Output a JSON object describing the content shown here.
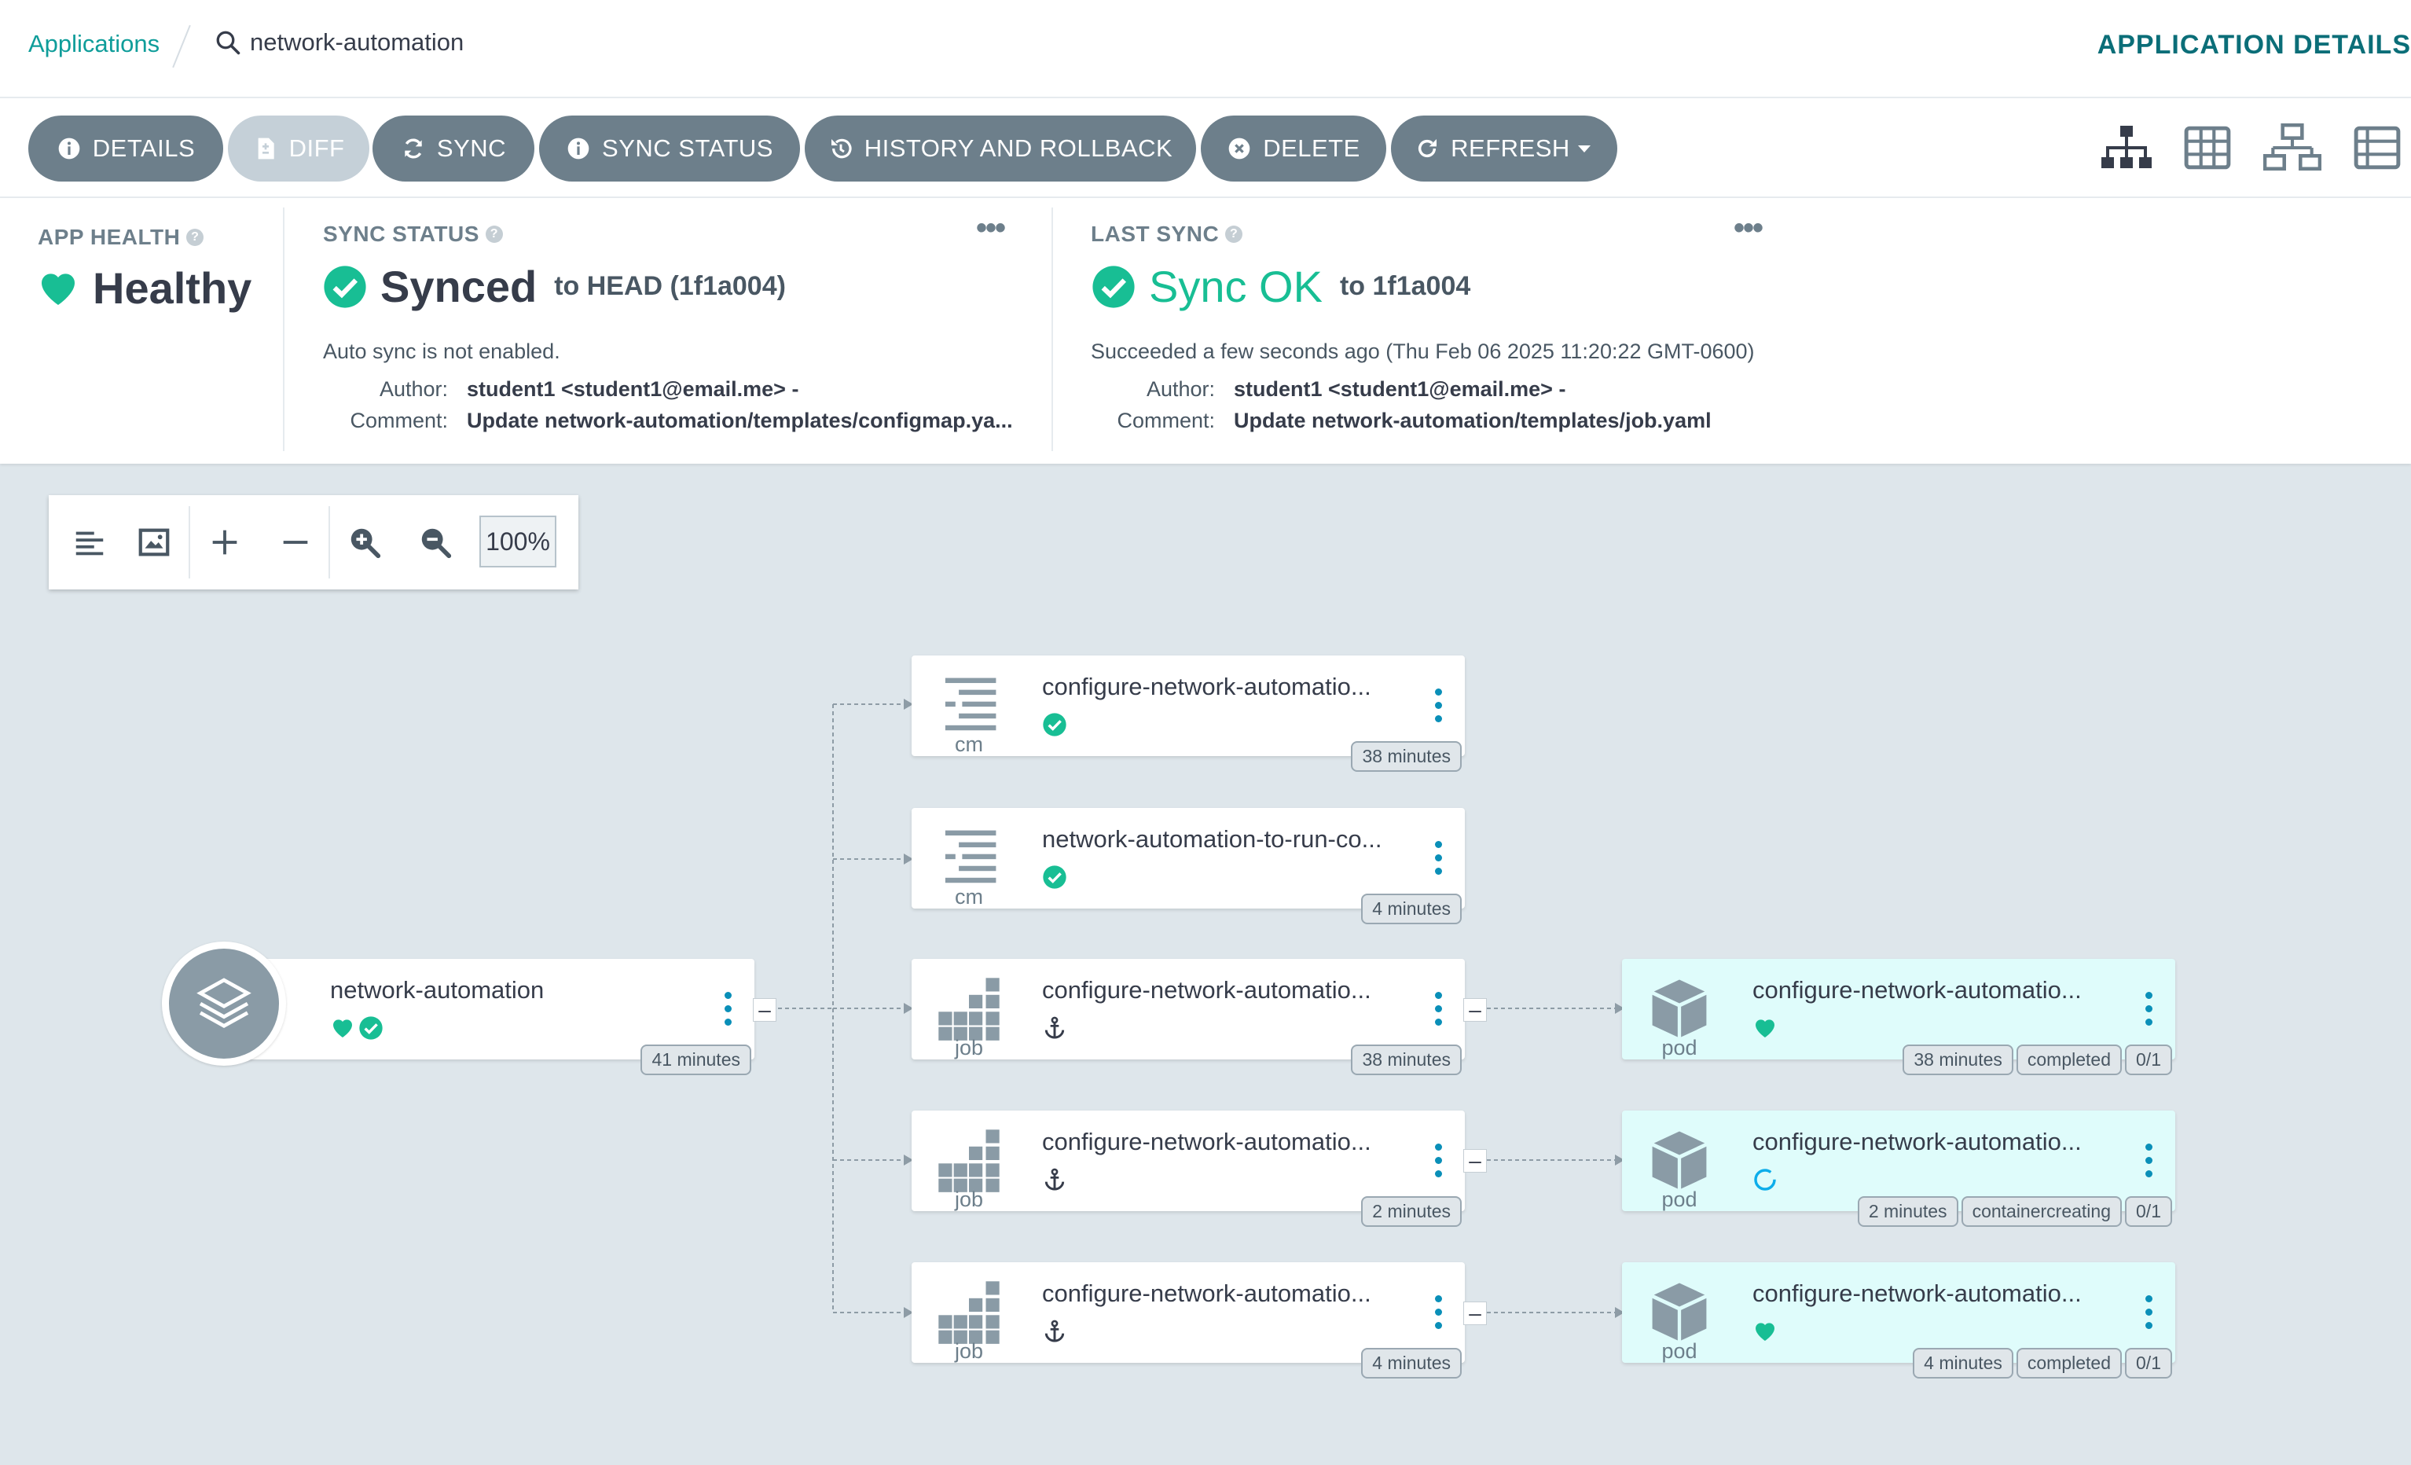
{
  "header": {
    "breadcrumb_app": "Applications",
    "search_value": "network-automation",
    "title": "APPLICATION DETAILS"
  },
  "toolbar": {
    "details": "DETAILS",
    "diff": "DIFF",
    "sync": "SYNC",
    "sync_status": "SYNC STATUS",
    "history": "HISTORY AND ROLLBACK",
    "delete": "DELETE",
    "refresh": "REFRESH"
  },
  "views": [
    "tree-view-icon",
    "pods-view-icon",
    "network-view-icon",
    "list-view-icon"
  ],
  "app_health": {
    "label": "APP HEALTH",
    "value": "Healthy",
    "color": "#18be94"
  },
  "sync_status": {
    "label": "SYNC STATUS",
    "value": "Synced",
    "target": "to HEAD (1f1a004)",
    "note": "Auto sync is not enabled.",
    "author_label": "Author:",
    "author": "student1 <student1@email.me> -",
    "comment_label": "Comment:",
    "comment": "Update network-automation/templates/configmap.ya..."
  },
  "last_sync": {
    "label": "LAST SYNC",
    "value": "Sync OK",
    "target": "to 1f1a004",
    "note": "Succeeded a few seconds ago (Thu Feb 06 2025 11:20:22 GMT-0600)",
    "author_label": "Author:",
    "author": "student1 <student1@email.me> -",
    "comment_label": "Comment:",
    "comment": "Update network-automation/templates/job.yaml"
  },
  "zoom": {
    "value": "100%"
  },
  "graph": {
    "app": {
      "name": "network-automation",
      "age": "41 minutes"
    },
    "resources": [
      {
        "kind": "cm",
        "name": "configure-network-automatio...",
        "age": "38 minutes"
      },
      {
        "kind": "cm",
        "name": "network-automation-to-run-co...",
        "age": "4 minutes"
      },
      {
        "kind": "job",
        "name": "configure-network-automatio...",
        "age": "38 minutes"
      },
      {
        "kind": "job",
        "name": "configure-network-automatio...",
        "age": "2 minutes"
      },
      {
        "kind": "job",
        "name": "configure-network-automatio...",
        "age": "4 minutes"
      }
    ],
    "pods": [
      {
        "kind": "pod",
        "name": "configure-network-automatio...",
        "age": "38 minutes",
        "phase": "completed",
        "ready": "0/1"
      },
      {
        "kind": "pod",
        "name": "configure-network-automatio...",
        "age": "2 minutes",
        "phase": "containercreating",
        "ready": "0/1"
      },
      {
        "kind": "pod",
        "name": "configure-network-automatio...",
        "age": "4 minutes",
        "phase": "completed",
        "ready": "0/1"
      }
    ]
  },
  "colors": {
    "accent": "#0f9d9a",
    "healthy": "#18be94",
    "button": "#6d7f8b",
    "pod_bg": "#dffcfb",
    "progressing": "#0dadea"
  }
}
